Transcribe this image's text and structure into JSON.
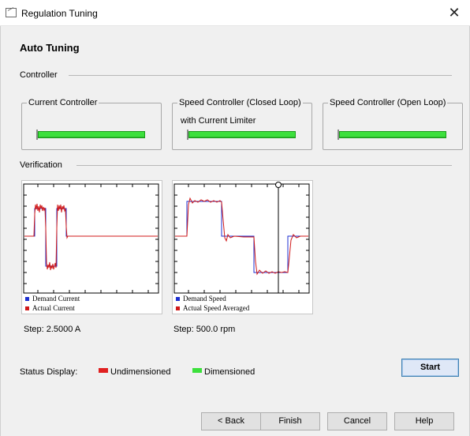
{
  "window": {
    "title": "Regulation Tuning",
    "close_glyph": "✕"
  },
  "heading": "Auto Tuning",
  "controller_section": {
    "label": "Controller",
    "groups": [
      {
        "title": "Current Controller",
        "subtitle": "",
        "status": "Dimensioned"
      },
      {
        "title": "Speed Controller (Closed Loop)",
        "subtitle": "with Current Limiter",
        "status": "Dimensioned"
      },
      {
        "title": "Speed Controller (Open Loop)",
        "subtitle": "",
        "status": "Dimensioned"
      }
    ]
  },
  "verification_section": {
    "label": "Verification",
    "plots": [
      {
        "legend": [
          "Demand Current",
          "Actual Current"
        ],
        "step": "Step: 2.5000 A"
      },
      {
        "legend": [
          "Demand Speed",
          "Actual Speed Averaged"
        ],
        "step": "Step: 500.0 rpm"
      }
    ]
  },
  "status_display": {
    "label": "Status Display:",
    "items": [
      {
        "label": "Undimensioned",
        "color": "#e02020"
      },
      {
        "label": "Dimensioned",
        "color": "#3ce03c"
      }
    ]
  },
  "colors": {
    "demand": "#1c2fd0",
    "actual": "#d01818"
  },
  "buttons": {
    "start": "Start",
    "back": "< Back",
    "finish": "Finish",
    "cancel": "Cancel",
    "help": "Help"
  }
}
